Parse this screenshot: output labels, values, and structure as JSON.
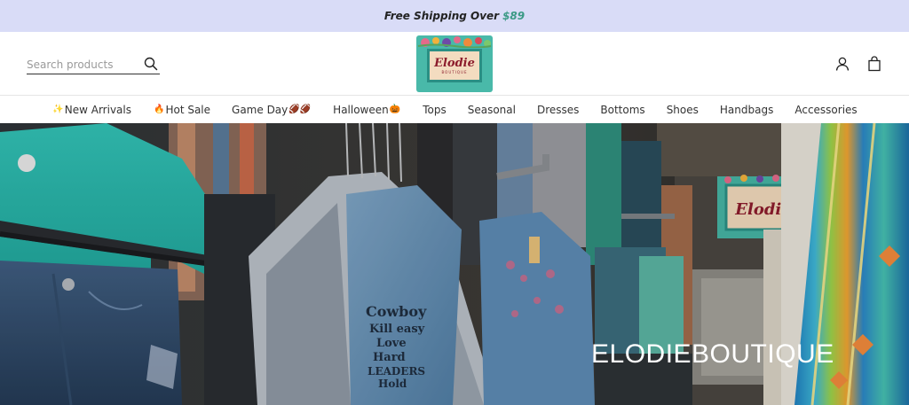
{
  "announcement": {
    "text": "Free Shipping Over",
    "price": "$89"
  },
  "header": {
    "search": {
      "placeholder": "Search products"
    },
    "logo": {
      "name": "Elodie",
      "sub": "BOUTIQUE"
    },
    "icons": [
      "search-icon",
      "account-icon",
      "shopping-bag-icon"
    ]
  },
  "nav": {
    "items": [
      {
        "label": "New Arrivals",
        "emoji_before": "✨"
      },
      {
        "label": "Hot Sale",
        "emoji_before": "🔥"
      },
      {
        "label": "Game Day",
        "emoji_after": "🏈🏈"
      },
      {
        "label": "Halloween",
        "emoji_after": "🎃"
      },
      {
        "label": "Tops"
      },
      {
        "label": "Seasonal"
      },
      {
        "label": "Dresses"
      },
      {
        "label": "Bottoms"
      },
      {
        "label": "Shoes"
      },
      {
        "label": "Handbags"
      },
      {
        "label": "Accessories"
      }
    ]
  },
  "hero": {
    "title": "ELODIEBOUTIQUE",
    "sign": "Elodie",
    "shirt_text": [
      "Cowboy",
      "Kill easy",
      "Love",
      "Hard",
      "LEADERS",
      "Hold"
    ]
  },
  "colors": {
    "announcement_bg": "#d9dcf7",
    "price_accent": "#3c9a86",
    "logo_teal": "#49b9a9",
    "logo_red": "#8c1c2c"
  }
}
